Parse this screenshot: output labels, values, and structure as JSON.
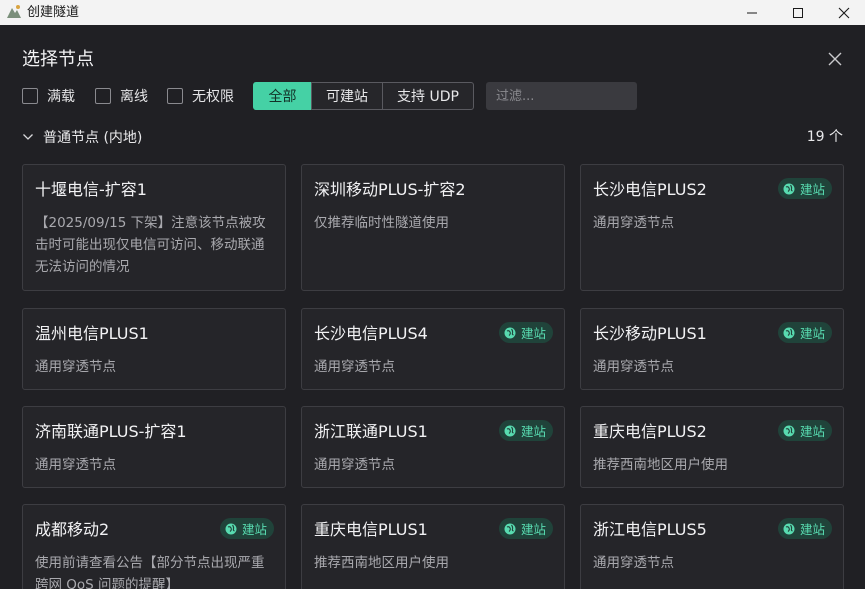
{
  "window": {
    "title": "创建隧道"
  },
  "dialog": {
    "title": "选择节点"
  },
  "filters": {
    "full": "满载",
    "offline": "离线",
    "unlimited": "无权限",
    "tabs": [
      "全部",
      "可建站",
      "支持 UDP"
    ],
    "search_placeholder": "过滤..."
  },
  "group": {
    "label": "普通节点 (内地)",
    "count": "19 个"
  },
  "badge_label": "建站",
  "colors": {
    "accent": "#45d1a5",
    "badge_text": "#58dbb0",
    "badge_bg": "#20433a"
  },
  "nodes": [
    {
      "name": "十堰电信-扩容1",
      "desc": "【2025/09/15 下架】注意该节点被攻击时可能出现仅电信可访问、移动联通无法访问的情况",
      "build": false
    },
    {
      "name": "深圳移动PLUS-扩容2",
      "desc": "仅推荐临时性隧道使用",
      "build": false
    },
    {
      "name": "长沙电信PLUS2",
      "desc": "通用穿透节点",
      "build": true
    },
    {
      "name": "温州电信PLUS1",
      "desc": "通用穿透节点",
      "build": false
    },
    {
      "name": "长沙电信PLUS4",
      "desc": "通用穿透节点",
      "build": true
    },
    {
      "name": "长沙移动PLUS1",
      "desc": "通用穿透节点",
      "build": true
    },
    {
      "name": "济南联通PLUS-扩容1",
      "desc": "通用穿透节点",
      "build": false
    },
    {
      "name": "浙江联通PLUS1",
      "desc": "通用穿透节点",
      "build": true
    },
    {
      "name": "重庆电信PLUS2",
      "desc": "推荐西南地区用户使用",
      "build": true
    },
    {
      "name": "成都移动2",
      "desc": "使用前请查看公告【部分节点出现严重跨网 QoS 问题的提醒】",
      "build": true
    },
    {
      "name": "重庆电信PLUS1",
      "desc": "推荐西南地区用户使用",
      "build": true
    },
    {
      "name": "浙江电信PLUS5",
      "desc": "通用穿透节点",
      "build": true
    }
  ]
}
